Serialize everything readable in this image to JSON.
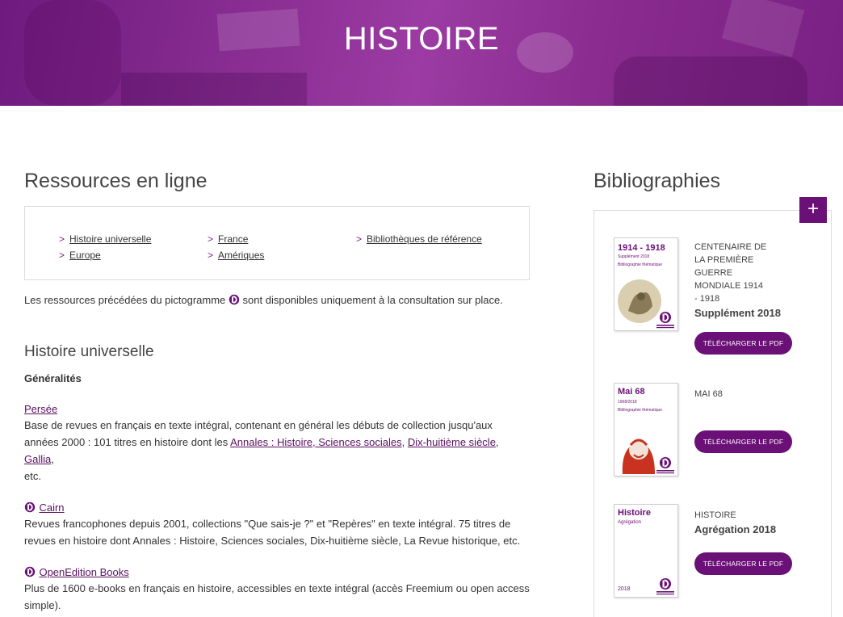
{
  "banner": {
    "title": "HISTOIRE"
  },
  "main": {
    "heading": "Ressources en ligne",
    "quick_links": [
      [
        "Histoire universelle",
        "Europe"
      ],
      [
        "France",
        "Amériques"
      ],
      [
        "Bibliothèques de référence"
      ]
    ],
    "note_before": "Les ressources précédées du pictogramme",
    "note_after": "sont disponibles uniquement à la consultation sur place.",
    "section_title": "Histoire universelle",
    "subsection": "Généralités",
    "entries": [
      {
        "title": "Persée",
        "desc_1": "Base de revues en français en texte intégral, contenant en général les débuts de collection jusqu'aux",
        "desc_2_prefix": "années 2000 : 101 titres en histoire dont les",
        "link_a": "Annales : Histoire, Sciences sociales",
        "sep_a": ",",
        "link_b": "Dix-huitième siècle",
        "sep_b": ",",
        "link_c": "Gallia",
        "desc_2_suffix": ",",
        "desc_3": "etc."
      },
      {
        "title": "Cairn",
        "desc_1": "Revues francophones depuis 2001, collections \"Que sais-je ?\" et \"Repères\" en texte intégral. 75 titres de",
        "desc_2": "revues en histoire dont Annales : Histoire, Sciences sociales, Dix-huitième siècle, La Revue historique, etc."
      },
      {
        "title": "OpenEdition Books",
        "desc_1": "Plus de 1600 e-books en français en histoire, accessibles en texte intégral (accès Freemium ou open access",
        "desc_2": "simple)."
      }
    ]
  },
  "side": {
    "heading": "Bibliographies",
    "plus": "+",
    "items": [
      {
        "cover_title": "1914 - 1918",
        "cover_sub": "Supplément 2018",
        "cover_bib": "Bibliographie thématique",
        "cover_year": "",
        "title_lines": [
          "CENTENAIRE DE",
          "LA PREMIÈRE",
          "GUERRE",
          "MONDIALE 1914",
          "- 1918"
        ],
        "subtitle": "Supplément 2018",
        "button": "TÉLÉCHARGER LE PDF"
      },
      {
        "cover_title": "Mai 68",
        "cover_sub": "1968/2018",
        "cover_bib": "Bibliographie thématique",
        "cover_year": "",
        "title_lines": [
          "MAI 68"
        ],
        "subtitle": "",
        "button": "TÉLÉCHARGER LE PDF"
      },
      {
        "cover_title": "Histoire",
        "cover_sub": "Agrégation",
        "cover_bib": "",
        "cover_year": "2018",
        "title_lines": [
          "HISTOIRE"
        ],
        "subtitle": "Agrégation 2018",
        "button": "TÉLÉCHARGER LE PDF"
      }
    ]
  },
  "colors": {
    "accent": "#6b1076",
    "banner": "#8a2e93"
  }
}
